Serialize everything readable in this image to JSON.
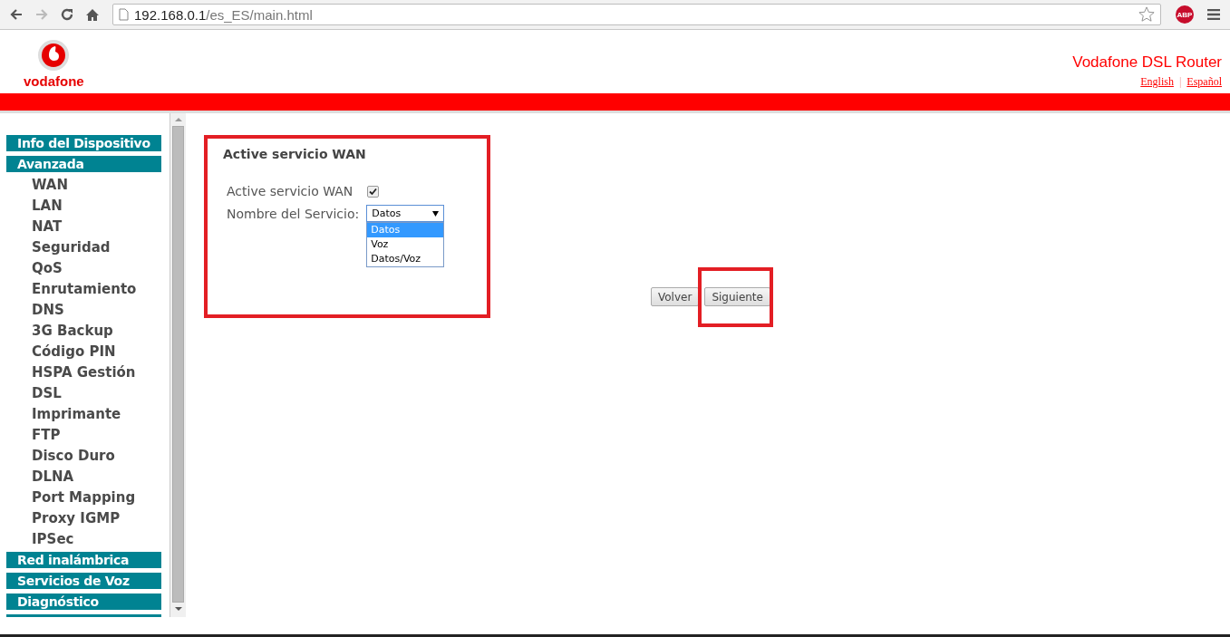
{
  "browser": {
    "url_host": "192.168.0.1",
    "url_path": "/es_ES/main.html",
    "extension_badge": "ABP"
  },
  "header": {
    "logo_text": "vodafone",
    "title": "Vodafone DSL Router",
    "languages": [
      "English",
      "Español"
    ],
    "language_separator": "|"
  },
  "sidebar": {
    "items": [
      {
        "kind": "heading",
        "label": "Info del Dispositivo"
      },
      {
        "kind": "heading",
        "label": "Avanzada",
        "children": [
          {
            "label": "WAN"
          },
          {
            "label": "LAN"
          },
          {
            "label": "NAT"
          },
          {
            "label": "Seguridad"
          },
          {
            "label": "QoS"
          },
          {
            "label": "Enrutamiento"
          },
          {
            "label": "DNS"
          },
          {
            "label": "3G Backup"
          },
          {
            "label": "Código PIN"
          },
          {
            "label": "HSPA Gestión"
          },
          {
            "label": "DSL"
          },
          {
            "label": "Imprimante"
          },
          {
            "label": "FTP"
          },
          {
            "label": "Disco Duro"
          },
          {
            "label": "DLNA"
          },
          {
            "label": "Port Mapping"
          },
          {
            "label": "Proxy IGMP"
          },
          {
            "label": "IPSec"
          }
        ]
      },
      {
        "kind": "heading",
        "label": "Red inalámbrica"
      },
      {
        "kind": "heading",
        "label": "Servicios de Voz"
      },
      {
        "kind": "heading",
        "label": "Diagnóstico"
      },
      {
        "kind": "cut"
      }
    ]
  },
  "form": {
    "title": "Active servicio WAN",
    "enable": {
      "label": "Active servicio WAN",
      "checked": true
    },
    "service": {
      "label": "Nombre del Servicio:",
      "value": "Datos",
      "expanded": true,
      "options": [
        {
          "label": "Datos",
          "selected": true
        },
        {
          "label": "Voz",
          "selected": false
        },
        {
          "label": "Datos/Voz",
          "selected": false
        }
      ]
    }
  },
  "buttons": [
    "Volver",
    "Siguiente"
  ]
}
